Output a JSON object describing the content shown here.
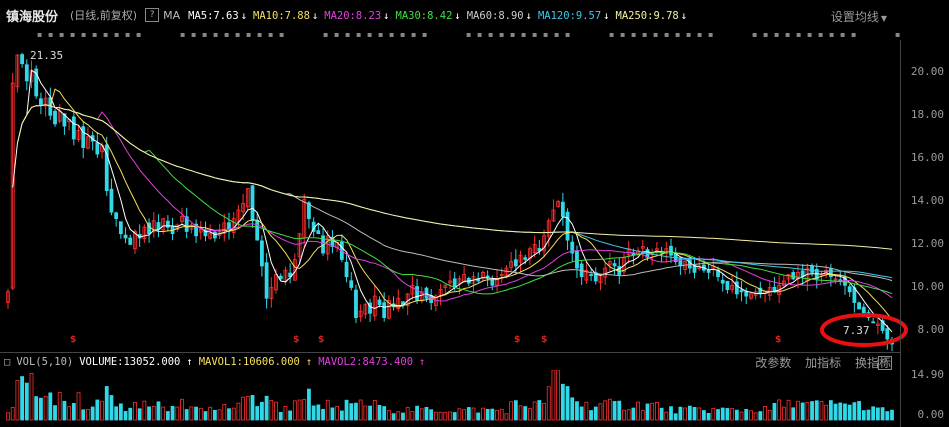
{
  "header": {
    "stock_name": "镇海股份",
    "period": "(日线,前复权)",
    "question_icon": "?",
    "ma_label": "MA",
    "ma_items": [
      {
        "text": "MA5:7.63",
        "color": "#ffffff",
        "arrow": "↓"
      },
      {
        "text": "MA10:7.88",
        "color": "#f5e05a",
        "arrow": "↓"
      },
      {
        "text": "MA20:8.23",
        "color": "#e040e0",
        "arrow": "↓"
      },
      {
        "text": "MA30:8.42",
        "color": "#40e040",
        "arrow": "↓"
      },
      {
        "text": "MA60:8.90",
        "color": "#cccccc",
        "arrow": "↓"
      },
      {
        "text": "MA120:9.57",
        "color": "#40c8e8",
        "arrow": "↓"
      },
      {
        "text": "MA250:9.78",
        "color": "#f5f0a0",
        "arrow": "↓"
      }
    ],
    "settings_label": "设置均线"
  },
  "price_axis": [
    "20.00",
    "18.00",
    "16.00",
    "14.00",
    "12.00",
    "10.00",
    "8.00"
  ],
  "annotations": {
    "high": "21.35",
    "low": "7.37"
  },
  "volume": {
    "label": "VOL(5,10)",
    "volume": "VOLUME:13052.000",
    "mavol1": "MAVOL1:10606.000",
    "mavol2": "MAVOL2:8473.400",
    "buttons": [
      "改参数",
      "加指标",
      "换指标"
    ],
    "question_icon": "?",
    "axis": [
      "14.90",
      "0.00"
    ]
  },
  "colors": {
    "up": "#ff3030",
    "down": "#30d8e8",
    "ma5": "#ffffff",
    "ma10": "#f5e05a",
    "ma20": "#e040e0",
    "ma30": "#40e040",
    "ma60": "#bbbbbb",
    "ma120": "#40c8e8",
    "ma250": "#f5f0a0",
    "highlight": "#e81010"
  },
  "chart_data": {
    "type": "candlestick",
    "ylim": [
      7.0,
      21.5
    ],
    "close": [
      9.8,
      19.5,
      20.8,
      20.4,
      19.6,
      20.1,
      18.9,
      18.5,
      18.8,
      18.0,
      17.6,
      18.2,
      17.5,
      17.8,
      16.9,
      17.3,
      16.5,
      17.0,
      16.8,
      16.2,
      16.6,
      14.5,
      13.5,
      13.2,
      12.5,
      12.3,
      12.0,
      12.6,
      12.3,
      12.8,
      12.5,
      13.1,
      12.7,
      13.2,
      12.8,
      12.5,
      12.9,
      13.3,
      12.6,
      12.9,
      12.4,
      12.7,
      12.4,
      12.5,
      12.3,
      12.6,
      13.0,
      12.7,
      13.2,
      13.6,
      13.9,
      14.6,
      13.1,
      12.2,
      11.0,
      9.5,
      10.0,
      10.6,
      10.4,
      10.8,
      10.5,
      11.3,
      12.5,
      14.1,
      13.2,
      12.6,
      12.5,
      11.6,
      12.4,
      11.9,
      12.1,
      11.3,
      10.5,
      10.0,
      8.6,
      8.9,
      9.2,
      8.8,
      9.6,
      9.2,
      8.6,
      9.4,
      9.1,
      9.5,
      9.2,
      9.7,
      10.1,
      9.4,
      9.8,
      9.5,
      9.3,
      9.6,
      9.9,
      10.1,
      10.3,
      10.0,
      10.4,
      10.6,
      10.2,
      10.5,
      10.3,
      10.7,
      10.5,
      10.1,
      10.4,
      10.6,
      10.9,
      11.2,
      11.0,
      11.5,
      11.3,
      11.8,
      12.0,
      11.7,
      12.4,
      13.1,
      13.6,
      14.0,
      13.3,
      12.2,
      11.6,
      10.9,
      10.5,
      10.8,
      10.6,
      10.3,
      10.6,
      10.9,
      11.2,
      11.0,
      10.6,
      11.4,
      11.8,
      11.5,
      11.7,
      11.9,
      11.4,
      11.6,
      11.8,
      11.6,
      11.8,
      11.5,
      11.2,
      11.0,
      11.2,
      10.9,
      10.7,
      11.0,
      10.8,
      10.7,
      11.0,
      10.5,
      10.2,
      9.9,
      10.1,
      9.7,
      9.8,
      9.6,
      9.7,
      9.8,
      9.7,
      9.8,
      10.0,
      9.8,
      10.1,
      10.3,
      10.6,
      10.4,
      10.7,
      10.5,
      10.9,
      10.7,
      10.4,
      10.6,
      10.8,
      10.5,
      10.4,
      10.3,
      10.1,
      9.8,
      9.3,
      9.0,
      8.7,
      8.6,
      8.4,
      8.3,
      8.0,
      7.6,
      7.37
    ],
    "volume_profile": [
      2,
      3,
      6,
      9,
      7,
      8,
      6,
      5,
      4,
      4,
      3,
      5,
      4,
      3,
      3,
      4,
      3,
      3,
      2,
      3,
      3,
      5,
      4,
      3,
      3,
      2,
      2,
      3,
      2,
      3,
      2,
      3,
      3,
      2,
      2,
      2,
      3,
      3,
      2,
      2,
      2,
      2,
      2,
      2,
      2,
      2,
      3,
      3,
      3,
      3,
      4,
      5,
      4,
      3,
      4,
      5,
      3,
      3,
      2,
      3,
      2,
      3,
      4,
      6,
      5,
      4,
      3,
      3,
      3,
      2,
      2,
      2,
      3,
      3,
      4,
      3,
      3,
      3,
      3,
      3,
      2,
      3,
      2,
      2,
      2,
      2,
      2,
      2,
      2,
      2,
      2,
      2,
      2,
      2,
      2,
      2,
      2,
      2,
      2,
      2,
      2,
      2,
      2,
      2,
      2,
      2,
      2,
      3,
      3,
      3,
      3,
      3,
      3,
      3,
      4,
      6,
      8,
      9,
      7,
      6,
      5,
      4,
      3,
      3,
      3,
      3,
      3,
      3,
      3,
      3,
      3,
      3,
      3,
      3,
      3,
      3,
      3,
      3,
      3,
      2,
      2,
      2,
      2,
      2,
      2,
      2,
      2,
      2,
      2,
      2,
      2,
      2,
      2,
      2,
      2,
      2,
      2,
      2,
      2,
      2,
      2,
      2,
      2,
      3,
      3,
      3,
      3,
      4,
      4,
      3,
      3,
      3,
      3,
      3,
      3,
      3,
      3,
      3,
      4,
      3,
      3,
      3,
      3,
      2,
      2,
      2,
      2,
      2,
      2,
      2
    ]
  }
}
